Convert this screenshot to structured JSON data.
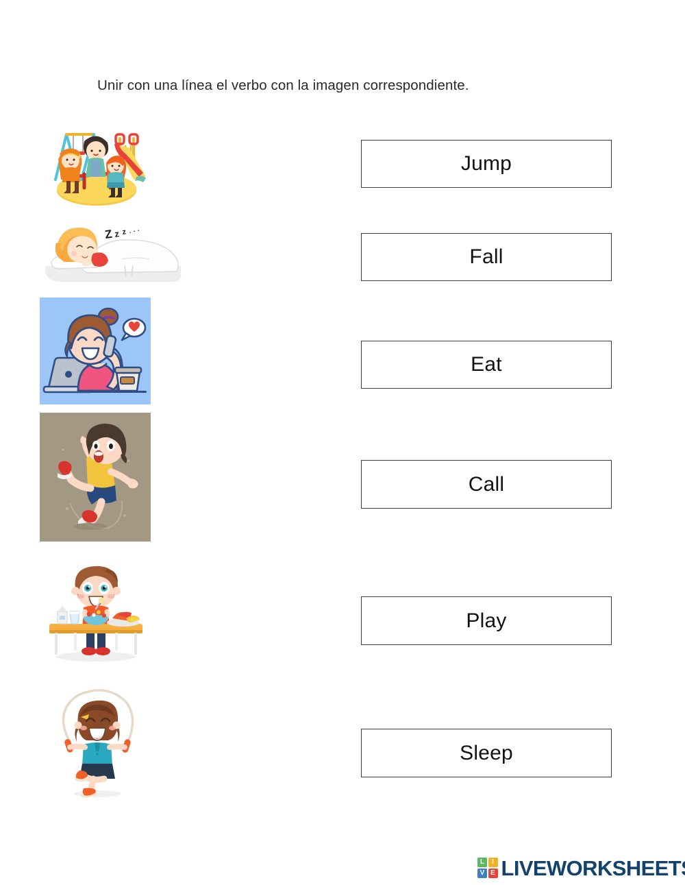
{
  "worksheet": {
    "instruction": "Unir con una línea el verbo con la imagen correspondiente.",
    "language": "Spanish instruction / English verbs",
    "activity_type": "match-picture-to-word"
  },
  "pictures": [
    {
      "index": 1,
      "name": "playground-children",
      "description": "Three children playing on a playground with swing set, slide and seesaw on a yellow round ground",
      "background": "#ffffff",
      "matches_word": "Play"
    },
    {
      "index": 2,
      "name": "girl-sleeping",
      "description": "Girl with orange hair sleeping in a bed under a white blanket with Zzzz above her",
      "background": "#ffffff",
      "zzz_text": "Zzzz...",
      "matches_word": "Sleep"
    },
    {
      "index": 3,
      "name": "girl-phone-call",
      "description": "Smiling girl talking on a mobile phone with laptop and coffee cup, heart speech bubble",
      "background": "#9CC6F7",
      "matches_word": "Call"
    },
    {
      "index": 4,
      "name": "boy-falling",
      "description": "Boy slipping and falling backwards on a taupe background",
      "background": "#A39883",
      "matches_word": "Fall"
    },
    {
      "index": 5,
      "name": "boy-eating",
      "description": "Boy eating a bowl of salad at a table with milk and fruit",
      "background": "#ffffff",
      "matches_word": "Eat"
    },
    {
      "index": 6,
      "name": "girl-jumping-rope",
      "description": "Girl jumping rope wearing a teal shirt and navy skirt",
      "background": "#ffffff",
      "matches_word": "Jump"
    }
  ],
  "word_boxes": [
    {
      "label": "Jump"
    },
    {
      "label": "Fall"
    },
    {
      "label": "Eat"
    },
    {
      "label": "Call"
    },
    {
      "label": "Play"
    },
    {
      "label": "Sleep"
    }
  ],
  "footer": {
    "logo_blocks": [
      "LI",
      "VE"
    ],
    "logo_letters": [
      "L",
      "I",
      "V",
      "E"
    ],
    "brand": "LIVEWORKSHEETS",
    "brand_color": "#12426e"
  }
}
